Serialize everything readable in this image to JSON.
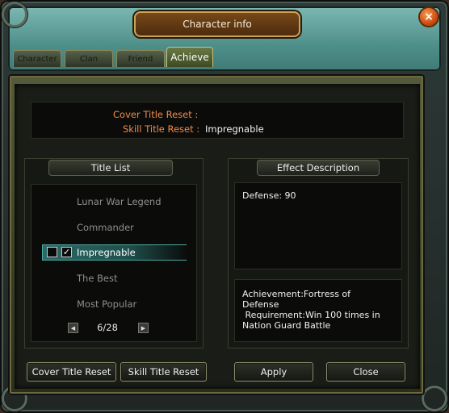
{
  "window": {
    "title": "Character info"
  },
  "tabs": [
    {
      "label": "Character",
      "active": false
    },
    {
      "label": "Clan",
      "active": false
    },
    {
      "label": "Friend",
      "active": false
    },
    {
      "label": "Achieve",
      "active": true
    }
  ],
  "title_info": {
    "cover_label": "Cover Title Reset :",
    "cover_value": "",
    "skill_label": "Skill Title Reset :",
    "skill_value": "Impregnable"
  },
  "title_list": {
    "header": "Title List",
    "items": [
      {
        "label": "Lunar War Legend",
        "selected": false
      },
      {
        "label": "Commander",
        "selected": false
      },
      {
        "label": "Impregnable",
        "selected": true,
        "checkbox_1": false,
        "checkbox_2": true
      },
      {
        "label": "The Best",
        "selected": false
      },
      {
        "label": "Most Popular",
        "selected": false
      }
    ],
    "page": "6/28",
    "prev_icon": "triangle-left-icon",
    "next_icon": "triangle-right-icon"
  },
  "effect": {
    "header": "Effect Description",
    "stats": "Defense: 90",
    "achievement_line1": "Achievement:Fortress of",
    "achievement_line2": "Defense",
    "requirement_line1": " Requirement:Win 100 times in",
    "requirement_line2": "Nation Guard Battle"
  },
  "buttons": {
    "cover_reset": "Cover Title Reset",
    "skill_reset": "Skill Title Reset",
    "apply": "Apply",
    "close": "Close"
  },
  "close_icon": "×",
  "colors": {
    "label_orange": "#f08a4a",
    "selection_teal": "#2a6a66",
    "header_teal": "#7db8b2"
  }
}
